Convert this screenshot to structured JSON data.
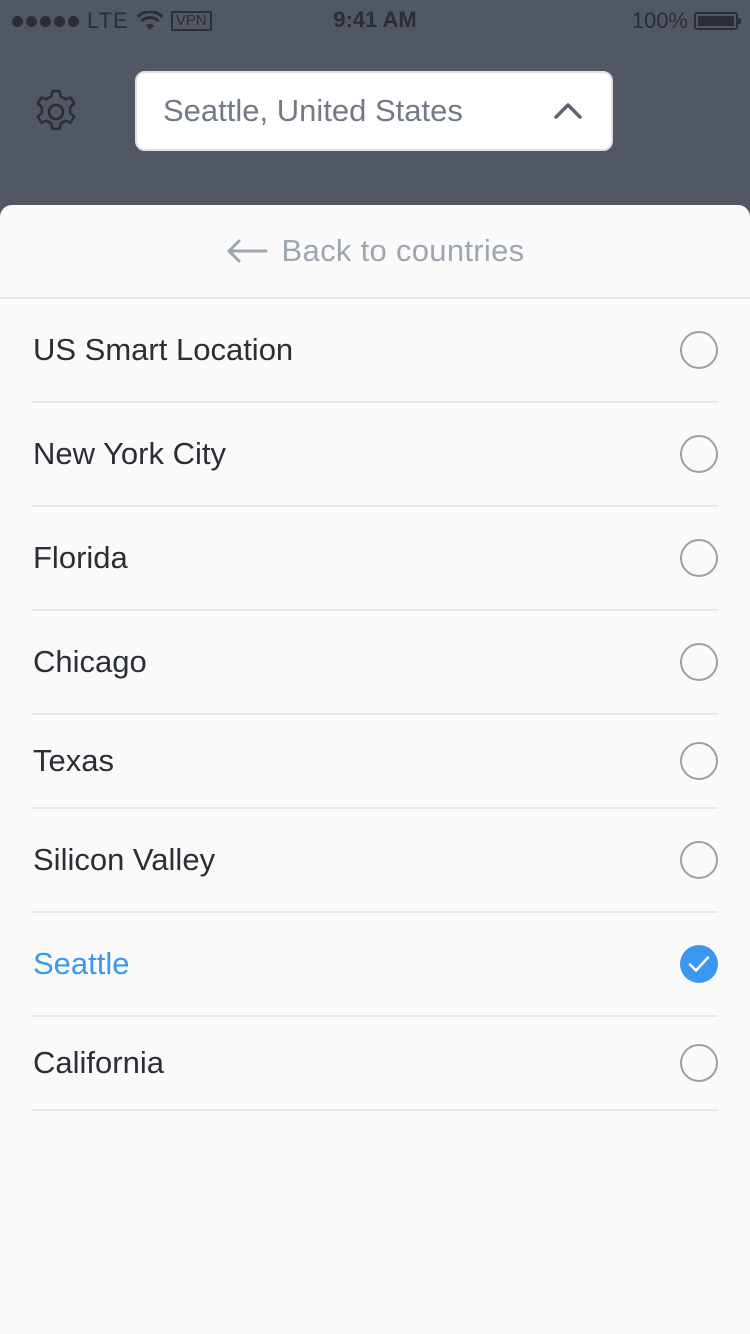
{
  "status_bar": {
    "carrier": "LTE",
    "vpn": "VPN",
    "time": "9:41 AM",
    "battery": "100%"
  },
  "header": {
    "selected_location": "Seattle, United States",
    "settings_icon": "gear-icon",
    "dropdown_icon": "chevron-up-icon"
  },
  "sheet": {
    "back_label": "Back to countries",
    "back_icon": "arrow-left-icon",
    "items": [
      {
        "label": "US Smart Location",
        "selected": false
      },
      {
        "label": "New York City",
        "selected": false
      },
      {
        "label": "Florida",
        "selected": false
      },
      {
        "label": "Chicago",
        "selected": false
      },
      {
        "label": "Texas",
        "selected": false
      },
      {
        "label": "Silicon Valley",
        "selected": false
      },
      {
        "label": "Seattle",
        "selected": true
      },
      {
        "label": "California",
        "selected": false
      }
    ]
  },
  "colors": {
    "background": "#525863",
    "accent": "#3b97f0",
    "text": "#2a2e35",
    "muted": "#9ea6b1"
  }
}
